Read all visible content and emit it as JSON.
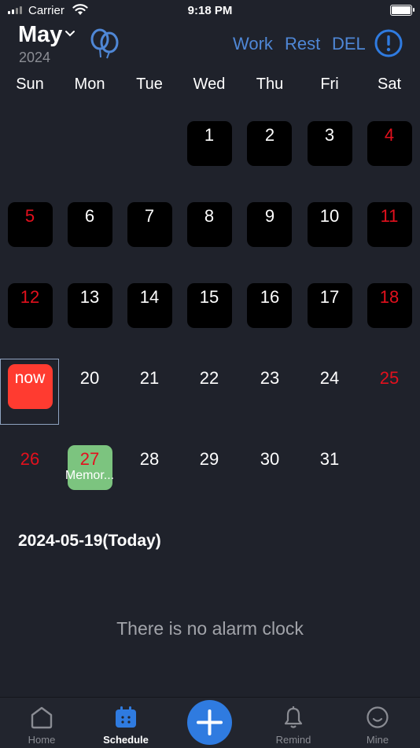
{
  "status_bar": {
    "carrier": "Carrier",
    "time": "9:18 PM"
  },
  "header": {
    "month": "May",
    "year": "2024",
    "buttons": {
      "work": "Work",
      "rest": "Rest",
      "del": "DEL"
    }
  },
  "weekdays": [
    "Sun",
    "Mon",
    "Tue",
    "Wed",
    "Thu",
    "Fri",
    "Sat"
  ],
  "calendar": {
    "days": [
      "1",
      "2",
      "3",
      "4",
      "5",
      "6",
      "7",
      "8",
      "9",
      "10",
      "11",
      "12",
      "13",
      "14",
      "15",
      "16",
      "17",
      "18",
      "now",
      "20",
      "21",
      "22",
      "23",
      "24",
      "25",
      "26",
      "27",
      "28",
      "29",
      "30",
      "31"
    ],
    "memo_label": "Memor..."
  },
  "selected_date_title": "2024-05-19(Today)",
  "empty_message": "There is no alarm clock",
  "tabs": {
    "home": "Home",
    "schedule": "Schedule",
    "remind": "Remind",
    "mine": "Mine"
  },
  "colors": {
    "accent": "#4f87d6",
    "weekend": "#e3101d",
    "today": "#ff3b30",
    "memo_day": "#7cc47f",
    "fab": "#2f7be0"
  }
}
